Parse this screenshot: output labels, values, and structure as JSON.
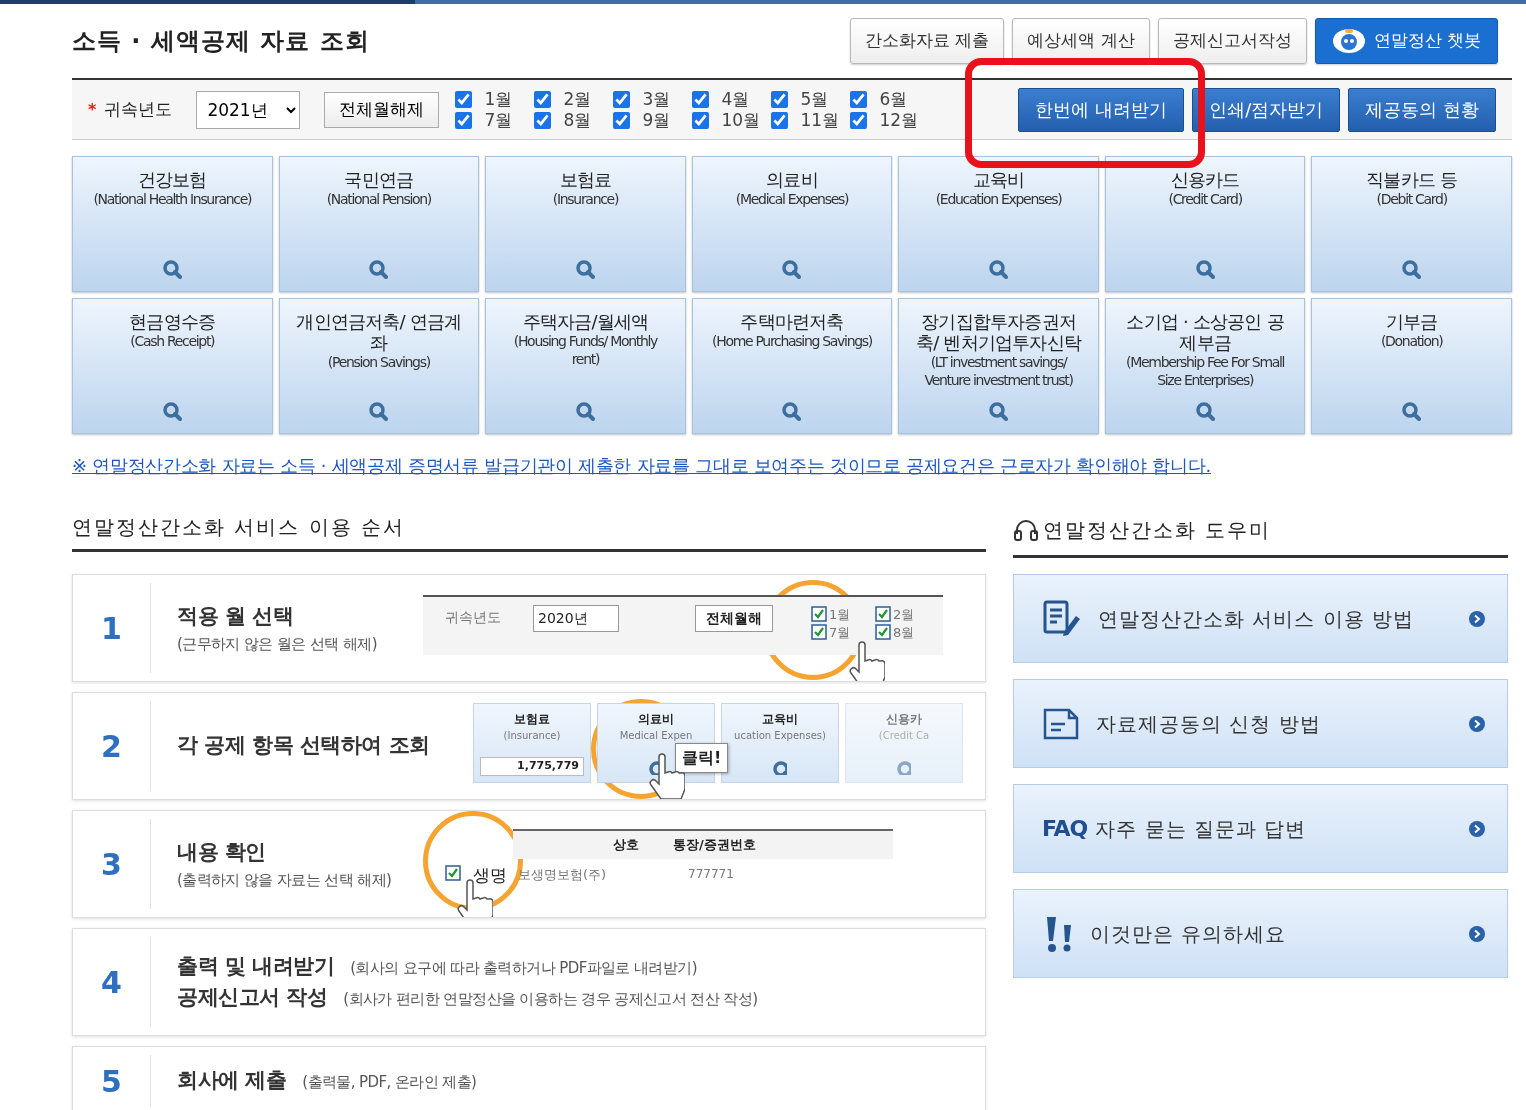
{
  "title": "소득 · 세액공제 자료 조회",
  "header_buttons": [
    {
      "label": "간소화자료 제출",
      "kind": "plain"
    },
    {
      "label": "예상세액 계산",
      "kind": "plain"
    },
    {
      "label": "공제신고서작성",
      "kind": "plain"
    },
    {
      "label": "연말정산 챗봇",
      "kind": "chatbot"
    }
  ],
  "filter": {
    "required_mark": "*",
    "label": "귀속년도",
    "year": "2021년",
    "clear_button": "전체월해제",
    "months": [
      {
        "label": "1월",
        "checked": true
      },
      {
        "label": "2월",
        "checked": true
      },
      {
        "label": "3월",
        "checked": true
      },
      {
        "label": "4월",
        "checked": true
      },
      {
        "label": "5월",
        "checked": true
      },
      {
        "label": "6월",
        "checked": true
      },
      {
        "label": "7월",
        "checked": true
      },
      {
        "label": "8월",
        "checked": true
      },
      {
        "label": "9월",
        "checked": true
      },
      {
        "label": "10월",
        "checked": true
      },
      {
        "label": "11월",
        "checked": true
      },
      {
        "label": "12월",
        "checked": true
      }
    ],
    "actions": [
      {
        "label": "한번에 내려받기",
        "highlighted": true
      },
      {
        "label": "인쇄/점자받기",
        "highlighted": false
      },
      {
        "label": "제공동의 현황",
        "highlighted": false
      }
    ]
  },
  "categories": [
    {
      "title": "건강보험",
      "subtitle": "(National Health Insurance)"
    },
    {
      "title": "국민연금",
      "subtitle": "(National Pension)"
    },
    {
      "title": "보험료",
      "subtitle": "(Insurance)"
    },
    {
      "title": "의료비",
      "subtitle": "(Medical Expenses)"
    },
    {
      "title": "교육비",
      "subtitle": "(Education Expenses)"
    },
    {
      "title": "신용카드",
      "subtitle": "(Credit Card)"
    },
    {
      "title": "직불카드 등",
      "subtitle": "(Debit Card)"
    },
    {
      "title": "현금영수증",
      "subtitle": "(Cash Receipt)"
    },
    {
      "title": "개인연금저축/ 연금계좌",
      "subtitle": "(Pension Savings)"
    },
    {
      "title": "주택자금/월세액",
      "subtitle": "(Housing Funds/ Monthly rent)"
    },
    {
      "title": "주택마련저축",
      "subtitle": "(Home Purchasing Savings)"
    },
    {
      "title": "장기집합투자증권저축/ 벤처기업투자신탁",
      "subtitle": "(LT investment savings/ Venture investment trust)"
    },
    {
      "title": "소기업 · 소상공인 공제부금",
      "subtitle": "(Membership Fee For Small Size Enterprises)"
    },
    {
      "title": "기부금",
      "subtitle": "(Donation)"
    }
  ],
  "notice": "※ 연말정산간소화 자료는 소득 · 세액공제 증명서류 발급기관이 제출한 자료를 그대로 보여주는 것이므로 공제요건은 근로자가 확인해야 합니다.",
  "steps_section": {
    "heading": "연말정산간소화 서비스 이용 순서",
    "steps": [
      {
        "number": "1",
        "kind": "stacked",
        "lines": [
          {
            "title": "적용 월 선택",
            "note": "(근무하지 않은 월은 선택 해제)"
          }
        ],
        "illustration": {
          "kind": "year_filter",
          "label": "귀속년도",
          "year": "2020년",
          "button": "전체월해",
          "months": [
            {
              "label": "1월",
              "checked": true
            },
            {
              "label": "7월",
              "checked": true
            },
            {
              "label": "2월",
              "checked": true
            },
            {
              "label": "8월",
              "checked": true
            }
          ]
        }
      },
      {
        "number": "2",
        "kind": "stacked",
        "lines": [
          {
            "title": "각 공제 항목 선택하여 조회"
          }
        ],
        "illustration": {
          "kind": "category_cards",
          "callout": "클릭!",
          "cards": [
            {
              "title": "보험료",
              "subtitle": "(Insurance)",
              "amount": "1,775,779"
            },
            {
              "title": "의료비",
              "subtitle": "Medical Expen"
            },
            {
              "title": "교육비",
              "subtitle": "ucation Expenses)"
            },
            {
              "title": "신용카",
              "subtitle": "(Credit Ca"
            }
          ]
        }
      },
      {
        "number": "3",
        "kind": "stacked",
        "lines": [
          {
            "title": "내용 확인",
            "note": "(출력하지 않을 자료는 선택 해제)"
          }
        ],
        "illustration": {
          "kind": "result_table",
          "columns": [
            "상호",
            "통장/증권번호"
          ],
          "rows": [
            {
              "checked": true,
              "magnified": "생명",
              "company": "보생명보험(주)",
              "number": "777771"
            }
          ]
        }
      },
      {
        "number": "4",
        "kind": "inline",
        "lines": [
          {
            "title": "출력 및 내려받기",
            "note": "(회사의 요구에 따라 출력하거나 PDF파일로 내려받기)"
          },
          {
            "title": "공제신고서 작성",
            "note": "(회사가 편리한 연말정산을 이용하는 경우 공제신고서 전산 작성)"
          }
        ]
      },
      {
        "number": "5",
        "kind": "inline",
        "lines": [
          {
            "title": "회사에 제출",
            "note": "(출력물, PDF, 온라인 제출)"
          }
        ]
      }
    ]
  },
  "helper": {
    "heading": "연말정산간소화 도우미",
    "items": [
      {
        "label": "연말정산간소화 서비스 이용 방법",
        "kind": "guide"
      },
      {
        "label": "자료제공동의 신청 방법",
        "kind": "form"
      },
      {
        "label": "자주 묻는 질문과 답변",
        "kind": "faq",
        "badge": "FAQ"
      },
      {
        "label": "이것만은 유의하세요",
        "kind": "caution"
      }
    ]
  }
}
